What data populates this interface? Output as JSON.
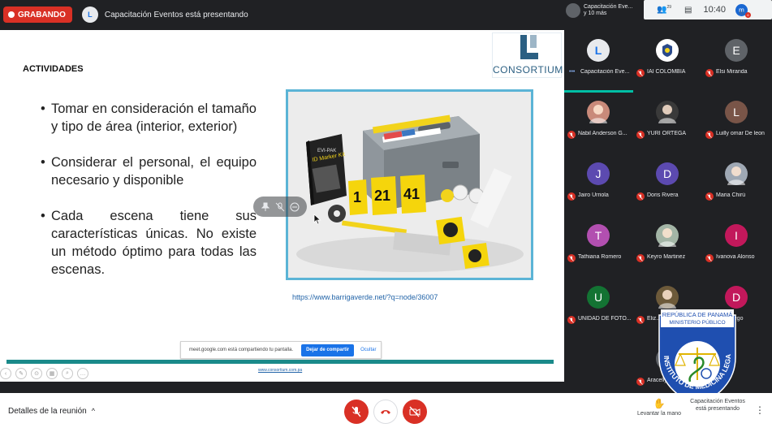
{
  "topbar": {
    "recording_label": "GRABANDO",
    "presenter_initial": "L",
    "title": "Capacitación Eventos está presentando"
  },
  "slide": {
    "heading": "ACTIVIDADES",
    "logo_text": "CONSORTIUM",
    "bullets": [
      "Tomar en consideración el tamaño y tipo de área (interior, exterior)",
      "Considerar el personal, el equipo necesario y disponible",
      "Cada escena tiene sus características únicas. No existe un método óptimo para todas las escenas."
    ],
    "photo": {
      "case_label": "EVI-PAK",
      "kit_label": "ID Marker Kit",
      "markers": [
        "1",
        "21",
        "41"
      ]
    },
    "url": "https://www.barrigaverde.net/?q=node/36007",
    "footer": "www.consortium.com.pa",
    "sharebar": {
      "text": "meet.google.com está compartiendo tu pantalla.",
      "stop_label": "Dejar de compartir",
      "hide_label": "Ocultar"
    }
  },
  "right_panel": {
    "presenter_tile": {
      "line1": "Capacitación Eve...",
      "line2": "y 10 más"
    },
    "participants_badge": "29",
    "time": "10:40",
    "account_initial": "m",
    "account_badge": "6",
    "account_caption": "TÚ",
    "participants": [
      {
        "name": "Capacitación Eve...",
        "initial": "L",
        "color": "#e8eaed",
        "type": "presenter"
      },
      {
        "name": "IAI COLOMBIA",
        "initial": "",
        "color": "#ffffff",
        "type": "logo"
      },
      {
        "name": "Elsi Miranda",
        "initial": "E",
        "color": "#5f6368",
        "type": "letter"
      },
      {
        "name": "Nabil Anderson G...",
        "initial": "",
        "color": "#c98a7a",
        "type": "photo"
      },
      {
        "name": "YURI ORTEGA",
        "initial": "",
        "color": "#3a3a3a",
        "type": "photo"
      },
      {
        "name": "Luilly omar De leon",
        "initial": "L",
        "color": "#795548",
        "type": "letter"
      },
      {
        "name": "Jairo Urriola",
        "initial": "J",
        "color": "#5c4ab0",
        "type": "letter"
      },
      {
        "name": "Doris Rivera",
        "initial": "D",
        "color": "#5c4ab0",
        "type": "letter"
      },
      {
        "name": "Maria Chirú",
        "initial": "",
        "color": "#9fa8b4",
        "type": "photo"
      },
      {
        "name": "Tathiana Romero",
        "initial": "T",
        "color": "#b24fb0",
        "type": "letter"
      },
      {
        "name": "Keyro Martinez",
        "initial": "",
        "color": "#a3b5a6",
        "type": "photo"
      },
      {
        "name": "Ivanova Alonso",
        "initial": "I",
        "color": "#c2185b",
        "type": "letter"
      },
      {
        "name": "UNIDAD DE FOTO...",
        "initial": "U",
        "color": "#137333",
        "type": "letter"
      },
      {
        "name": "Eliz...",
        "initial": "",
        "color": "#6d5a3a",
        "type": "photo"
      },
      {
        "name": "...s Abrego",
        "initial": "D",
        "color": "#c2185b",
        "type": "letter"
      },
      {
        "name": "Aracellys Ru...",
        "initial": "",
        "color": "#5f6368",
        "type": "letter"
      }
    ]
  },
  "bottombar": {
    "details_label": "Detalles de la reunión",
    "raise_hand_label": "Levantar la mano",
    "presenting_line1": "Capacitación Eventos",
    "presenting_line2": "está presentando"
  },
  "seal": {
    "top_text": "REPÚBLICA DE PANAMÁ",
    "sub_text": "MINISTERIO PÚBLICO",
    "arc_text": "INSTITUTO DE MEDICINA LEGAL Y CIENCIAS FORENSES"
  },
  "colors": {
    "record_red": "#d93025",
    "meet_dark": "#202124",
    "accent_blue": "#1a73e8",
    "slide_teal": "#1a8a8a",
    "photo_border": "#5bb4d6"
  }
}
